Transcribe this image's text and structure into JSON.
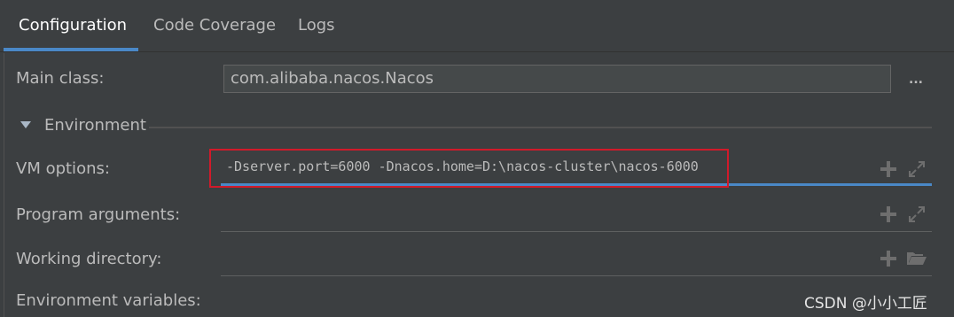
{
  "tabs": [
    {
      "label": "Configuration",
      "active": true
    },
    {
      "label": "Code Coverage",
      "active": false
    },
    {
      "label": "Logs",
      "active": false
    }
  ],
  "main_class": {
    "label": "Main class:",
    "value": "com.alibaba.nacos.Nacos",
    "browse_label": "..."
  },
  "environment_section": {
    "label": "Environment",
    "expanded": true
  },
  "vm_options": {
    "label": "VM options:",
    "value": "-Dserver.port=6000 -Dnacos.home=D:\\nacos-cluster\\nacos-6000"
  },
  "program_arguments": {
    "label": "Program arguments:",
    "value": ""
  },
  "working_directory": {
    "label": "Working directory:",
    "value": ""
  },
  "environment_variables": {
    "label": "Environment variables:"
  },
  "watermark": "CSDN @小小工匠",
  "colors": {
    "background": "#3c3f41",
    "accent": "#4a88c7",
    "highlight": "#d11a2a",
    "text": "#bbbbbb"
  },
  "icons": [
    "plus-icon",
    "expand-icon",
    "folder-icon",
    "triangle-down-icon",
    "browse-icon"
  ]
}
